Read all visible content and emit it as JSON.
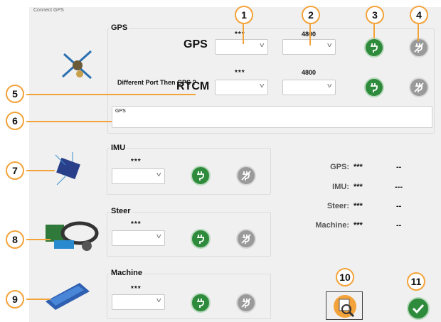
{
  "window": {
    "title": "Connect GPS"
  },
  "gps_group": {
    "label": "GPS",
    "gps_row": {
      "label": "GPS",
      "port": "***",
      "baud": "4800"
    },
    "rtcm_row": {
      "label": "RTCM",
      "port": "***",
      "baud": "4800",
      "question": "Different Port Then GPS ?"
    },
    "message_box": "GPS"
  },
  "imu_group": {
    "label": "IMU",
    "port": "***"
  },
  "steer_group": {
    "label": "Steer",
    "port": "***"
  },
  "machine_group": {
    "label": "Machine",
    "port": "***"
  },
  "status": [
    {
      "label": "GPS:",
      "value": "***",
      "state": "--"
    },
    {
      "label": "IMU:",
      "value": "***",
      "state": "---"
    },
    {
      "label": "Steer:",
      "value": "***",
      "state": "--"
    },
    {
      "label": "Machine:",
      "value": "***",
      "state": "--"
    }
  ],
  "callouts": [
    "1",
    "2",
    "3",
    "4",
    "5",
    "6",
    "7",
    "8",
    "9",
    "10",
    "11"
  ],
  "colors": {
    "accent": "#f3a33a",
    "connect": "#2e8b3c",
    "disabled": "#9a9a9a",
    "background": "#f0f0f0"
  }
}
